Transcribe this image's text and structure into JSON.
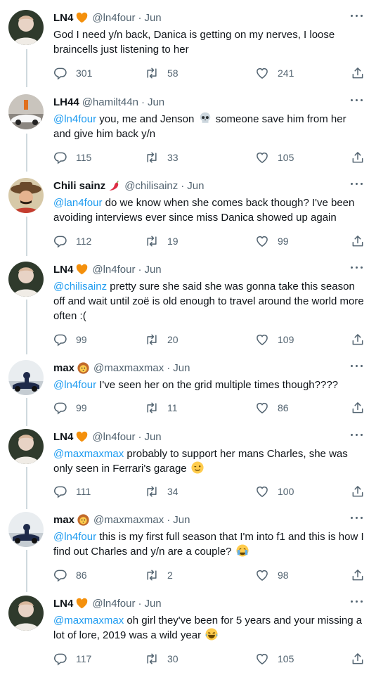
{
  "tweets": [
    {
      "name": "LN4",
      "badge": "orange-heart-emoji",
      "handle": "@ln4four",
      "time": "Jun",
      "mention": "",
      "text": "God I need y/n back, Danica is getting on my nerves, I loose braincells just listening to her",
      "replies": "301",
      "retweets": "58",
      "likes": "241"
    },
    {
      "name": "LH44",
      "badge": "",
      "handle": "@hamilt44n",
      "time": "Jun",
      "mention": "@ln4four",
      "text_a": " you, me and Jenson ",
      "text_b": " someone save him from her and give him back y/n",
      "replies": "115",
      "retweets": "33",
      "likes": "105"
    },
    {
      "name": "Chili sainz",
      "badge": "hot-pepper-emoji",
      "handle": "@chilisainz",
      "time": "Jun",
      "mention": "@lan4four",
      "text": " do we know when she comes back though? I've been avoiding interviews ever since miss Danica showed up again",
      "replies": "112",
      "retweets": "19",
      "likes": "99"
    },
    {
      "name": "LN4",
      "badge": "orange-heart-emoji",
      "handle": "@ln4four",
      "time": "Jun",
      "mention": "@chilisainz",
      "text": " pretty sure she said she was gonna take this season off and wait until zoë is old enough to travel around the world more often :(",
      "replies": "99",
      "retweets": "20",
      "likes": "109"
    },
    {
      "name": "max",
      "badge": "lion-emoji",
      "handle": "@maxmaxmax",
      "time": "Jun",
      "mention": "@ln4four",
      "text": " I've seen her on the grid multiple times though????",
      "replies": "99",
      "retweets": "11",
      "likes": "86"
    },
    {
      "name": "LN4",
      "badge": "orange-heart-emoji",
      "handle": "@ln4four",
      "time": "Jun",
      "mention": "@maxmaxmax",
      "text": " probably to support her mans Charles, she was only seen in Ferrari's garage ",
      "replies": "111",
      "retweets": "34",
      "likes": "100"
    },
    {
      "name": "max",
      "badge": "lion-emoji",
      "handle": "@maxmaxmax",
      "time": "Jun",
      "mention": "@ln4four",
      "text": " this is my first full season that I'm into f1 and this is how I find out Charles and y/n are a couple? ",
      "replies": "86",
      "retweets": "2",
      "likes": "98"
    },
    {
      "name": "LN4",
      "badge": "orange-heart-emoji",
      "handle": "@ln4four",
      "time": "Jun",
      "mention": "@maxmaxmax",
      "text": " oh girl they've been for 5 years and your missing a lot of lore, 2019 was a wild year ",
      "replies": "117",
      "retweets": "30",
      "likes": "105"
    }
  ],
  "separator": "·",
  "colors": {
    "text": "#0f1419",
    "secondary": "#536471",
    "link": "#1d9bf0",
    "thread_line": "#cfd9de"
  }
}
